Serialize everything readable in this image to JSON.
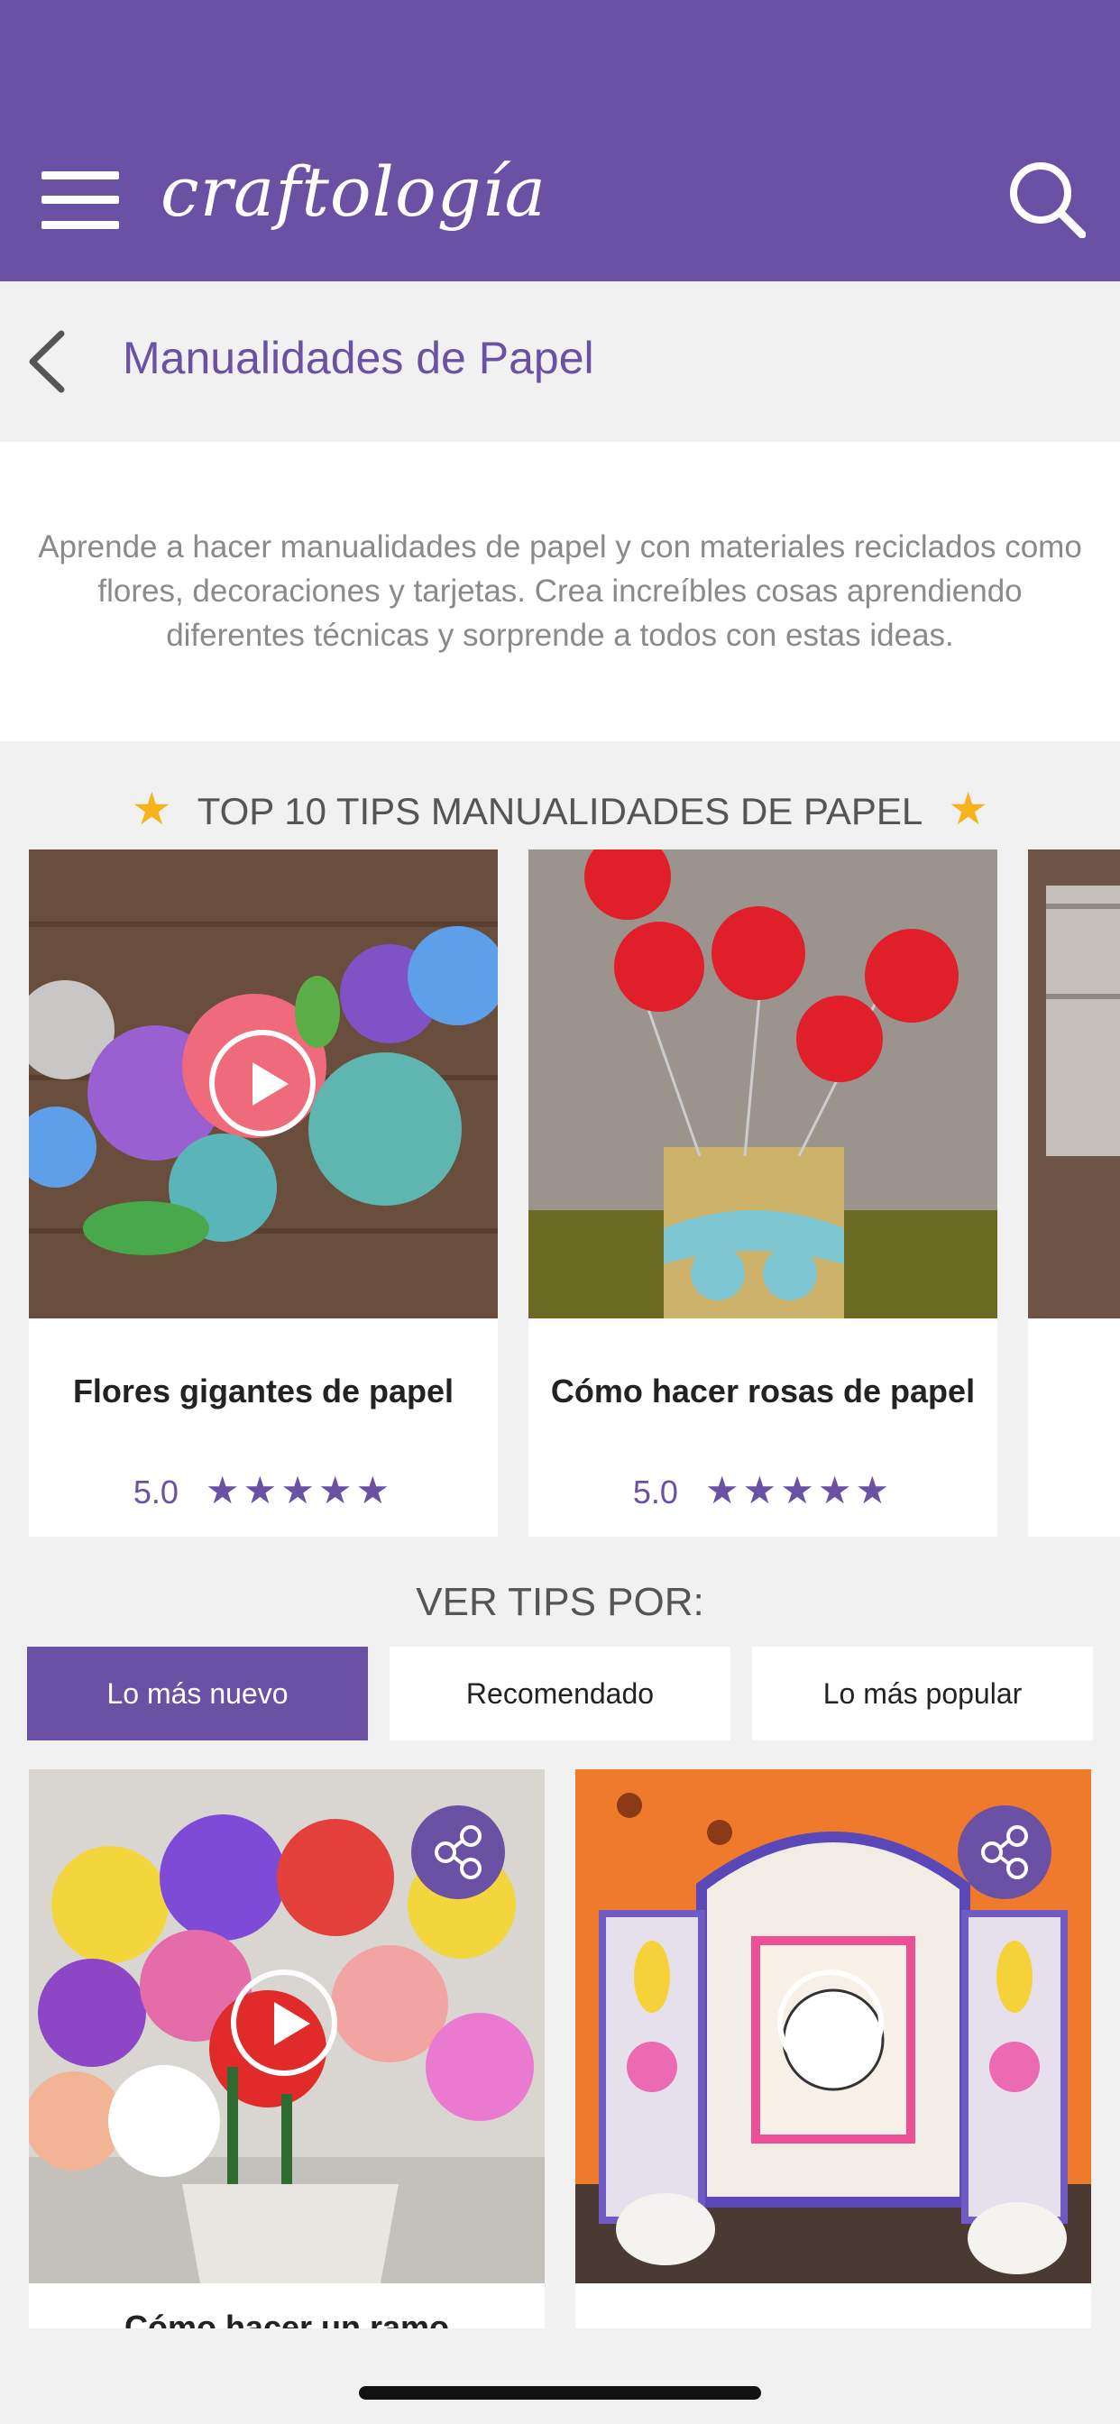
{
  "header": {
    "logo_text": "craftología",
    "menu_icon": "hamburger-icon",
    "search_icon": "search-icon",
    "brand_color": "#6b51a4"
  },
  "title_bar": {
    "back_icon": "chevron-left-icon",
    "title": "Manualidades de Papel"
  },
  "description": "Aprende a hacer manualidades de papel y con materiales reciclados como flores, decoraciones y tarjetas. Crea increíbles cosas aprendiendo diferentes técnicas y sorprende a todos con estas ideas.",
  "top_section": {
    "title": "TOP 10 TIPS MANUALIDADES DE PAPEL",
    "star_color": "#f6b31b",
    "cards": [
      {
        "title": "Flores gigantes de papel",
        "rating": "5.0",
        "stars": 5,
        "has_video": true
      },
      {
        "title": "Cómo hacer rosas de papel",
        "rating": "5.0",
        "stars": 5,
        "has_video": false
      }
    ]
  },
  "filter_section": {
    "title": "VER TIPS POR:",
    "options": [
      "Lo más nuevo",
      "Recomendado",
      "Lo más popular"
    ],
    "selected": "Lo más nuevo"
  },
  "grid": [
    {
      "title": "Cómo hacer un ramo",
      "has_video": true,
      "share_icon": "share-icon"
    },
    {
      "title": "",
      "has_video": true,
      "share_icon": "share-icon"
    }
  ]
}
